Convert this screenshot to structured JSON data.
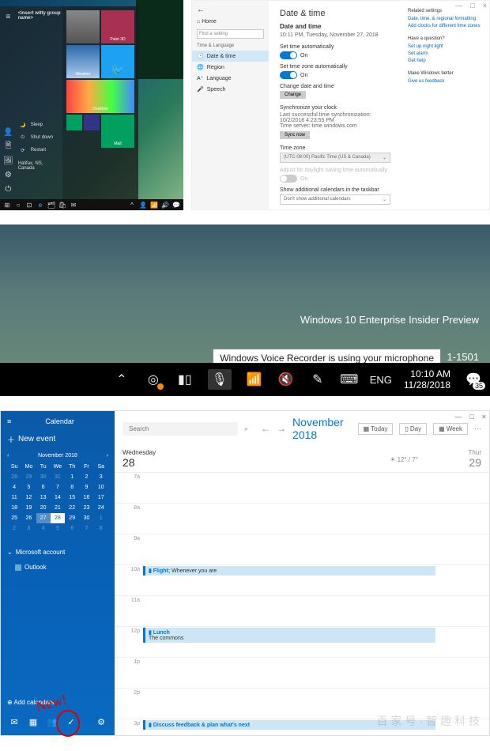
{
  "s1": {
    "start": {
      "header": "<insert witty group name>",
      "pinned": [
        {
          "label": "Paint 3D",
          "color": "#a83050"
        },
        {
          "label": "Weather",
          "color": "#2a4a6a"
        },
        {
          "label": "Halifax, NS, Canada",
          "color": "#2a4a6a"
        },
        {
          "label": "OneNote",
          "color": "#7a2a7a"
        },
        {
          "label": "Twitter",
          "color": "#1da1f2"
        },
        {
          "label": "Mail",
          "color": "#00a060"
        }
      ],
      "power": {
        "sleep": "Sleep",
        "shutdown": "Shut down",
        "restart": "Restart"
      }
    },
    "settings": {
      "home": "Home",
      "search_placeholder": "Find a setting",
      "category": "Time & Language",
      "items": [
        "Date & time",
        "Region",
        "Language",
        "Speech"
      ],
      "title": "Date & time",
      "subtitle": "Date and time",
      "current": "10:11 PM, Tuesday, November 27, 2018",
      "auto_time_label": "Set time automatically",
      "auto_time_on": "On",
      "auto_tz_label": "Set time zone automatically",
      "auto_tz_on": "On",
      "change_label": "Change date and time",
      "change_btn": "Change",
      "sync_label": "Synchronize your clock",
      "sync_detail": "Last successful time synchronization: 10/2/2018 4:23:55 PM",
      "sync_server": "Time server: time.windows.com",
      "sync_btn": "Sync now",
      "tz_label": "Time zone",
      "tz_value": "(UTC-08:00) Pacific Time (US & Canada)",
      "dst_label": "Adjust for daylight saving time automatically",
      "dst_on": "On",
      "extra_label": "Show additional calendars in the taskbar",
      "extra_value": "Don't show additional calendars",
      "related": {
        "hdr": "Related settings",
        "links": [
          "Date, time, & regional formatting",
          "Add clocks for different time zones"
        ]
      },
      "question": {
        "hdr": "Have a question?",
        "links": [
          "Set up night light",
          "Set alarm",
          "Get help"
        ]
      },
      "better": {
        "hdr": "Make Windows better",
        "links": [
          "Give us feedback"
        ]
      }
    }
  },
  "s2": {
    "watermark1": "Windows 10 Enterprise Insider Preview",
    "watermark2": "1-1501",
    "tooltip": "Windows Voice Recorder is using your microphone",
    "lang": "ENG",
    "time": "10:10 AM",
    "date": "11/28/2018",
    "badge": "35"
  },
  "s3": {
    "app": "Calendar",
    "new_event": "New event",
    "month": "November 2018",
    "dow": [
      "Su",
      "Mo",
      "Tu",
      "We",
      "Th",
      "Fr",
      "Sa"
    ],
    "weeks": [
      [
        "28",
        "29",
        "30",
        "31",
        "1",
        "2",
        "3"
      ],
      [
        "4",
        "5",
        "6",
        "7",
        "8",
        "9",
        "10"
      ],
      [
        "11",
        "12",
        "13",
        "14",
        "15",
        "16",
        "17"
      ],
      [
        "18",
        "19",
        "20",
        "21",
        "22",
        "23",
        "24"
      ],
      [
        "25",
        "26",
        "27",
        "28",
        "29",
        "30",
        "1"
      ],
      [
        "2",
        "3",
        "4",
        "5",
        "6",
        "7",
        "8"
      ]
    ],
    "today_idx": [
      4,
      2
    ],
    "sel_idx": [
      4,
      3
    ],
    "accounts": [
      "Microsoft account",
      "Outlook"
    ],
    "add_cal": "Add calendars",
    "search_placeholder": "Search",
    "header_month": "November 2018",
    "views": {
      "today": "Today",
      "day": "Day",
      "week": "Week"
    },
    "day_label": "Wednesday",
    "day_num": "28",
    "weather": "12° / 7°",
    "next_day_label": "Thur",
    "next_day_num": "29",
    "hours": [
      "7a",
      "8a",
      "9a",
      "10a",
      "11a",
      "12p",
      "1p",
      "2p",
      "3p"
    ],
    "events": {
      "10a": {
        "title": "Flight;",
        "sub": "Whenever you are"
      },
      "12p": {
        "title": "Lunch",
        "sub": "The commons"
      },
      "3p": {
        "title": "Discuss feedback & plan what's next",
        "sub": ""
      }
    },
    "annotation": "New!"
  },
  "watermark": "百家号·智趣科技"
}
